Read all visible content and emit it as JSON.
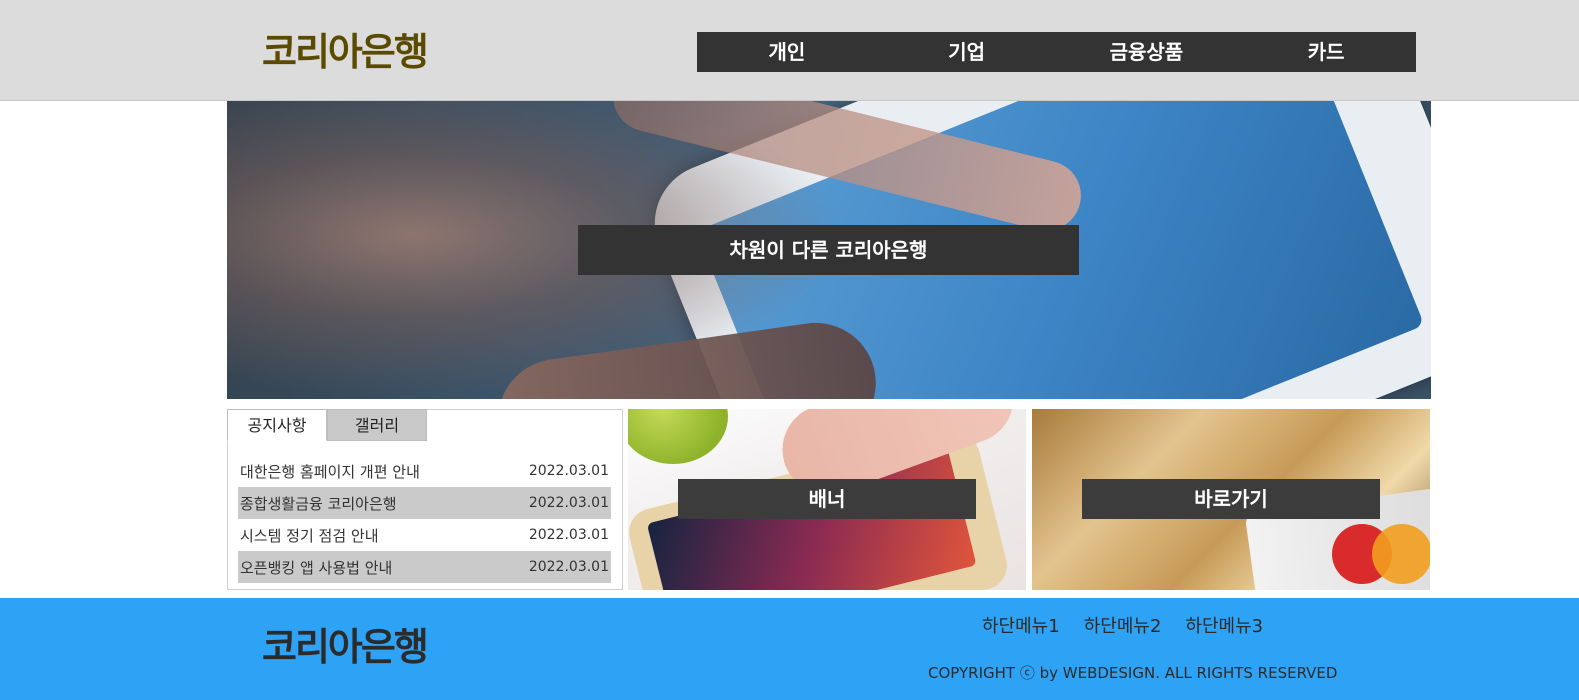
{
  "header": {
    "logo": "코리아은행",
    "nav": [
      "개인",
      "기업",
      "금융상품",
      "카드"
    ]
  },
  "hero": {
    "caption": "차원이 다른 코리아은행"
  },
  "notice": {
    "tabs": [
      "공지사항",
      "갤러리"
    ],
    "items": [
      {
        "title": "대한은행 홈페이지 개편 안내",
        "date": "2022.03.01"
      },
      {
        "title": "종합생활금융 코리아은행",
        "date": "2022.03.01"
      },
      {
        "title": "시스템 정기 점검 안내",
        "date": "2022.03.01"
      },
      {
        "title": "오픈뱅킹 앱 사용법 안내",
        "date": "2022.03.01"
      }
    ]
  },
  "banners": {
    "banner1": "배너",
    "banner2": "바로가기"
  },
  "footer": {
    "logo": "코리아은행",
    "menu": [
      "하단메뉴1",
      "하단메뉴2",
      "하단메뉴3"
    ],
    "copyright": "COPYRIGHT ⓒ by WEBDESIGN. ALL RIGHTS RESERVED"
  },
  "colors": {
    "header_bg": "#dcdcdc",
    "logo": "#5b4b00",
    "nav_bg": "#333333",
    "footer_bg": "#2ea2f5"
  }
}
